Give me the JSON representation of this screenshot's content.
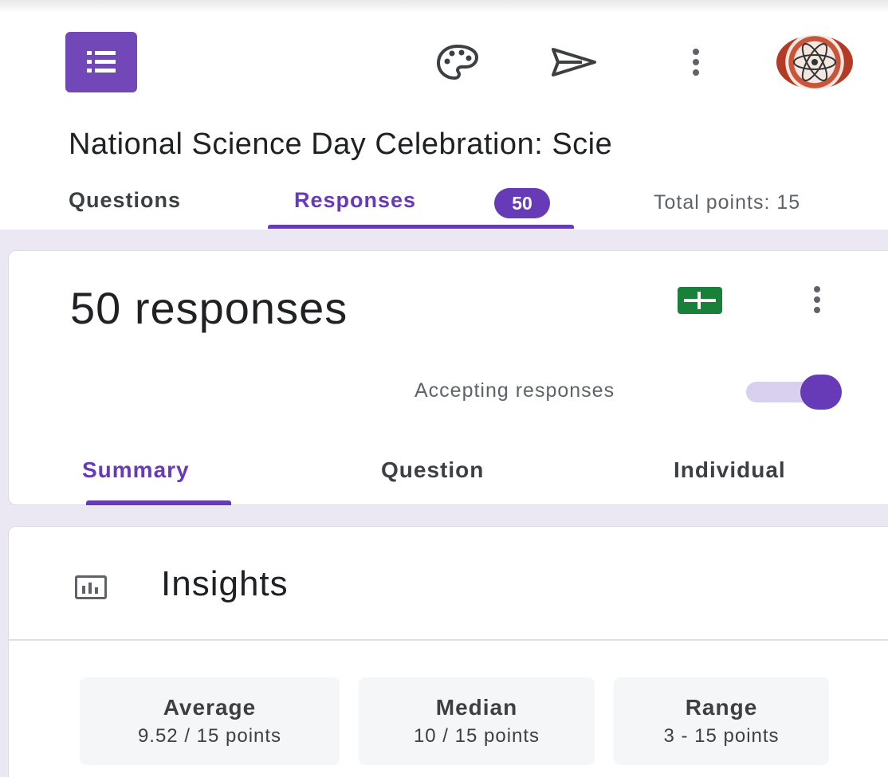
{
  "header": {
    "icons": [
      "forms-logo-icon",
      "palette-icon",
      "send-icon",
      "more-vert-icon",
      "avatar"
    ]
  },
  "form": {
    "title": "National Science Day Celebration: Scie"
  },
  "tabs": {
    "questions": "Questions",
    "responses": "Responses",
    "responses_badge": "50",
    "total_points": "Total points: 15"
  },
  "responses_card": {
    "count_label": "50 responses",
    "accepting_label": "Accepting responses",
    "accepting": true,
    "subtabs": {
      "summary": "Summary",
      "question": "Question",
      "individual": "Individual"
    }
  },
  "insights": {
    "title": "Insights",
    "stats": {
      "average_label": "Average",
      "average_value": "9.52 / 15 points",
      "median_label": "Median",
      "median_value": "10 / 15 points",
      "range_label": "Range",
      "range_value": "3 - 15 points"
    }
  },
  "colors": {
    "accent": "#673ab7",
    "sheets_green": "#188038",
    "band": "#ebe8f3"
  }
}
